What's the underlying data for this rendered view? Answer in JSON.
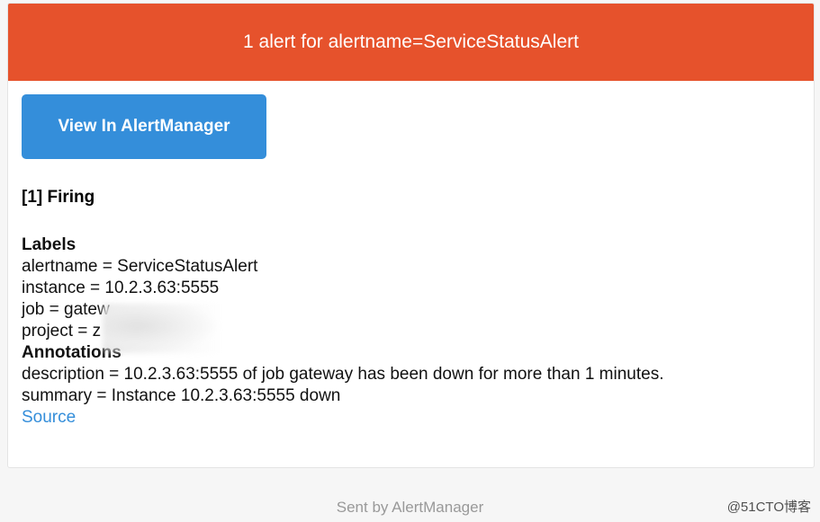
{
  "header": {
    "title": "1 alert for alertname=ServiceStatusAlert"
  },
  "action": {
    "view_label": "View In AlertManager"
  },
  "status": {
    "firing_label": "[1] Firing"
  },
  "labels": {
    "title": "Labels",
    "items": [
      "alertname = ServiceStatusAlert",
      "instance = 10.2.3.63:5555",
      "job = gatew",
      "project = z"
    ]
  },
  "annotations": {
    "title": "Annotations",
    "items": [
      "description = 10.2.3.63:5555 of job gateway has been down for more than 1 minutes.",
      "summary = Instance 10.2.3.63:5555 down"
    ]
  },
  "source": {
    "label": "Source"
  },
  "footer": {
    "text": "Sent by AlertManager"
  },
  "watermark": {
    "text": "@51CTO博客"
  },
  "colors": {
    "header_bg": "#e6522c",
    "button_bg": "#348eda",
    "link": "#348eda"
  }
}
